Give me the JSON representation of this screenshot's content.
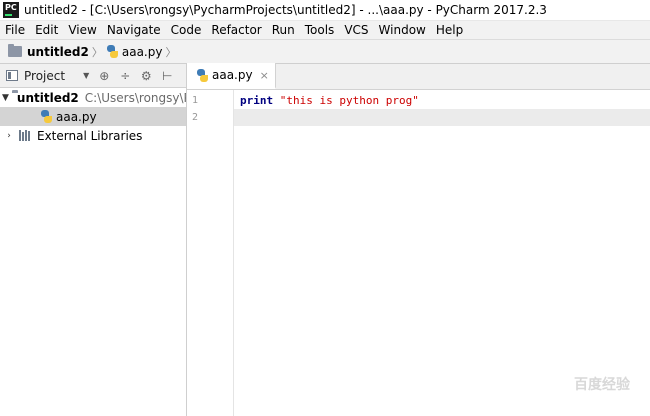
{
  "window": {
    "title": "untitled2 - [C:\\Users\\rongsy\\PycharmProjects\\untitled2] - ...\\aaa.py - PyCharm 2017.2.3",
    "app_icon_text": "PC"
  },
  "menu": [
    {
      "label": "File"
    },
    {
      "label": "Edit"
    },
    {
      "label": "View"
    },
    {
      "label": "Navigate"
    },
    {
      "label": "Code"
    },
    {
      "label": "Refactor"
    },
    {
      "label": "Run"
    },
    {
      "label": "Tools"
    },
    {
      "label": "VCS"
    },
    {
      "label": "Window"
    },
    {
      "label": "Help"
    }
  ],
  "breadcrumb": {
    "project": "untitled2",
    "separator": "〉",
    "file": "aaa.py"
  },
  "project_panel": {
    "title": "Project",
    "dropdown_glyph": "▼",
    "tools": [
      "⊕",
      "÷",
      "⚙",
      "⊢"
    ],
    "tree": [
      {
        "arrow": "▼",
        "name": "untitled2",
        "path": "C:\\Users\\rongsy\\P"
      },
      {
        "name": "aaa.py"
      },
      {
        "arrow": "›",
        "name": "External Libraries"
      }
    ]
  },
  "editor": {
    "tab_label": "aaa.py",
    "tab_close": "×",
    "lines": [
      {
        "number": "1",
        "keyword": "print",
        "string": "\"this is python prog\""
      },
      {
        "number": "2"
      }
    ]
  },
  "watermark": "百度经验",
  "colors": {
    "keyword": "#000080",
    "string": "#cc0000",
    "caret_row": "#ebebeb",
    "selected_row": "#d4d4d4"
  }
}
